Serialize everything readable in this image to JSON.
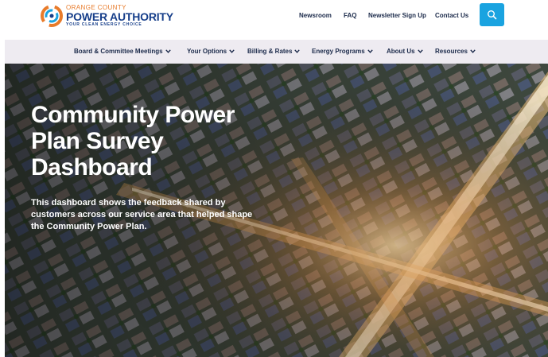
{
  "brand": {
    "line1": "ORANGE COUNTY",
    "line2": "POWER AUTHORITY",
    "tagline": "YOUR CLEAN ENERGY CHOICE",
    "colors": {
      "orange": "#e87b2a",
      "navy": "#163e8a",
      "blue": "#1aa3e0"
    }
  },
  "utility_nav": [
    {
      "label": "Newsroom"
    },
    {
      "label": "FAQ"
    },
    {
      "label": "Newsletter Sign Up"
    },
    {
      "label": "Contact Us"
    }
  ],
  "search": {
    "icon": "search-icon",
    "color": "#1aa3e0"
  },
  "main_nav": [
    {
      "label": "Board & Committee Meetings",
      "icon": "chevron-down-icon"
    },
    {
      "label": "Your Options",
      "icon": "chevron-down-icon"
    },
    {
      "label": "Billing & Rates",
      "icon": "chevron-down-icon"
    },
    {
      "label": "Energy Programs",
      "icon": "chevron-down-icon"
    },
    {
      "label": "About Us",
      "icon": "chevron-down-icon"
    },
    {
      "label": "Resources",
      "icon": "chevron-down-icon"
    }
  ],
  "hero": {
    "title": "Community Power Plan Survey Dashboard",
    "description": "This dashboard shows the feedback shared by customers across our service area that helped shape the Community Power Plan."
  }
}
